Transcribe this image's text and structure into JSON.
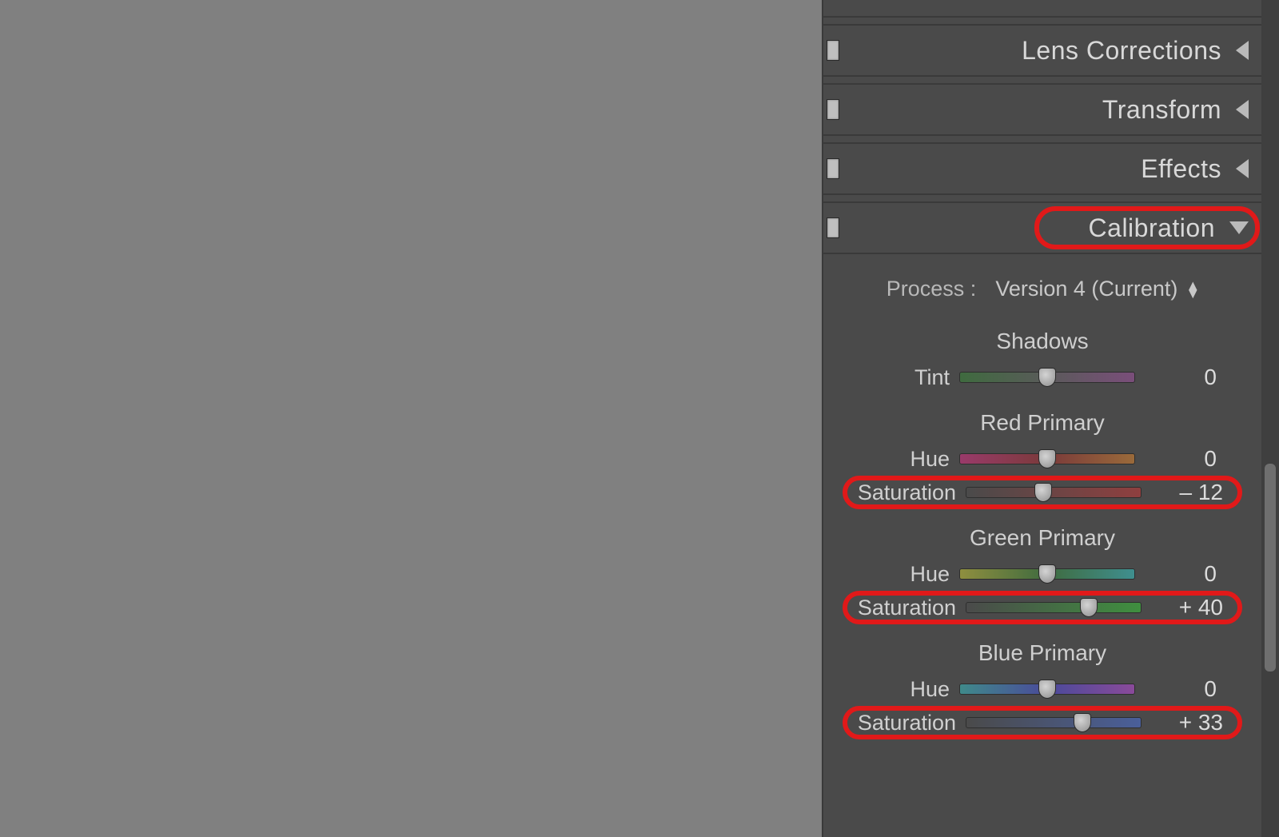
{
  "panels": {
    "lens_corrections": {
      "title": "Lens Corrections",
      "expanded": false
    },
    "transform": {
      "title": "Transform",
      "expanded": false
    },
    "effects": {
      "title": "Effects",
      "expanded": false
    },
    "calibration": {
      "title": "Calibration",
      "expanded": true
    }
  },
  "calibration": {
    "process_label": "Process :",
    "process_value": "Version 4 (Current)",
    "groups": {
      "shadows": {
        "title": "Shadows",
        "tint_label": "Tint",
        "tint_value": "0"
      },
      "red": {
        "title": "Red Primary",
        "hue_label": "Hue",
        "hue_value": "0",
        "sat_label": "Saturation",
        "sat_value": "– 12"
      },
      "green": {
        "title": "Green Primary",
        "hue_label": "Hue",
        "hue_value": "0",
        "sat_label": "Saturation",
        "sat_value": "+ 40"
      },
      "blue": {
        "title": "Blue Primary",
        "hue_label": "Hue",
        "hue_value": "0",
        "sat_label": "Saturation",
        "sat_value": "+ 33"
      }
    }
  },
  "slider_positions_percent": {
    "shadows_tint": 50,
    "red_hue": 50,
    "red_sat": 44,
    "green_hue": 50,
    "green_sat": 70,
    "blue_hue": 50,
    "blue_sat": 66.5
  }
}
